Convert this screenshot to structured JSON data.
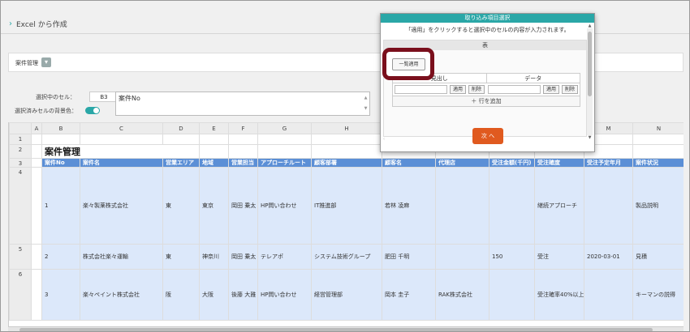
{
  "breadcrumb": {
    "title": "Excel から作成"
  },
  "sheet_selector": {
    "label": "案件管理",
    "chevron": "chevron-down-icon"
  },
  "selection": {
    "cell_label": "選択中のセル：",
    "cell_ref": "B3",
    "bg_label": "選択済みセルの背景色：",
    "cell_value": "案件No"
  },
  "grid": {
    "columns": [
      "A",
      "B",
      "C",
      "D",
      "E",
      "F",
      "G",
      "H",
      "I",
      "J",
      "K",
      "L",
      "M",
      "N"
    ],
    "row_numbers": [
      "1",
      "2",
      "3",
      "4",
      "5",
      "6"
    ],
    "sheet_title": "案件管理",
    "headers": [
      "案件No",
      "案件名",
      "営業エリア",
      "地域",
      "営業担当",
      "アプローチルート",
      "顧客部署",
      "顧客名",
      "代理店",
      "受注金額(千円)",
      "受注確度",
      "受注予定年月",
      "案件状況"
    ],
    "rows": [
      [
        "1",
        "楽々製薬株式会社",
        "東",
        "東京",
        "岡田 乗太",
        "HP問い合わせ",
        "IT推進部",
        "若林 凌麻",
        "",
        "",
        "継続アプローチ",
        "",
        "製品説明"
      ],
      [
        "2",
        "株式会社楽々運輸",
        "東",
        "神奈川",
        "岡田 乗太",
        "テレアポ",
        "システム技術グループ",
        "肥田 千明",
        "",
        "150",
        "受注",
        "2020-03-01",
        "見積"
      ],
      [
        "3",
        "楽々ペイント株式会社",
        "阪",
        "大阪",
        "後藤 大雅",
        "HP問い合わせ",
        "経営管理部",
        "岡本 圭子",
        "RAK株式会社",
        "",
        "受注確率40%以上",
        "",
        "キーマンの説得"
      ]
    ]
  },
  "dialog": {
    "title": "取り込み項目選択",
    "description": "「適用」をクリックすると選択中のセルの内容が入力されます。",
    "section_label": "表",
    "bulk_apply": "一覧適用",
    "col_headers": [
      "見出し",
      "データ"
    ],
    "apply": "適用",
    "delete": "削除",
    "add_row": "行を追加",
    "next": "次 へ"
  }
}
